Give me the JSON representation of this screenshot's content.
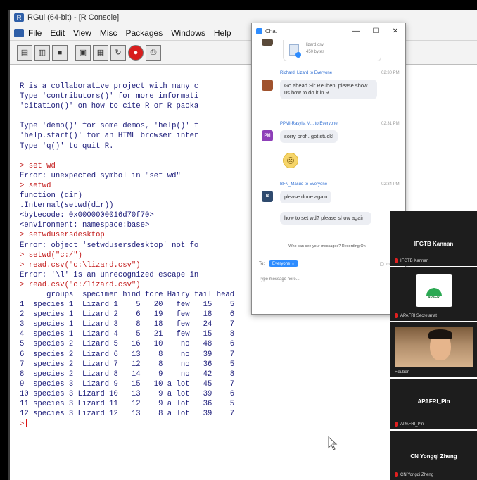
{
  "rgui": {
    "title": "RGui (64-bit) - [R Console]",
    "menu": [
      "File",
      "Edit",
      "View",
      "Misc",
      "Packages",
      "Windows",
      "Help"
    ],
    "toolbar_icons": [
      "open-script-icon",
      "load-workspace-icon",
      "save-workspace-icon",
      "copy-icon",
      "paste-icon",
      "copy-paste-icon",
      "stop-icon",
      "print-icon"
    ]
  },
  "console": {
    "intro": [
      "R is a collaborative project with many c",
      "Type 'contributors()' for more informati",
      "'citation()' on how to cite R or R packa",
      "",
      "Type 'demo()' for some demos, 'help()' f",
      "'help.start()' for an HTML browser inter",
      "Type 'q()' to quit R.",
      ""
    ],
    "lines": [
      {
        "k": "cmd",
        "t": "> set wd"
      },
      {
        "k": "out",
        "t": "Error: unexpected symbol in \"set wd\""
      },
      {
        "k": "cmd",
        "t": "> setwd"
      },
      {
        "k": "out",
        "t": "function (dir)"
      },
      {
        "k": "out",
        "t": ".Internal(setwd(dir))"
      },
      {
        "k": "out",
        "t": "<bytecode: 0x0000000016d70f70>"
      },
      {
        "k": "out",
        "t": "<environment: namespace:base>"
      },
      {
        "k": "cmd",
        "t": "> setwdusersdesktop"
      },
      {
        "k": "out",
        "t": "Error: object 'setwdusersdesktop' not fo"
      },
      {
        "k": "cmd",
        "t": "> setwd(\"c:/\")"
      },
      {
        "k": "cmd",
        "t": "> read.csv(\"c:\\lizard.csv\")"
      },
      {
        "k": "out",
        "t": "Error: '\\l' is an unrecognized escape in"
      },
      {
        "k": "cmd",
        "t": "> read.csv(\"c:/lizard.csv\")"
      },
      {
        "k": "out",
        "t": "      groups  specimen hind fore Hairy tail head"
      },
      {
        "k": "out",
        "t": "1  species 1  Lizard 1    5   20   few   15    5"
      },
      {
        "k": "out",
        "t": "2  species 1  Lizard 2    6   19   few   18    6"
      },
      {
        "k": "out",
        "t": "3  species 1  Lizard 3    8   18   few   24    7"
      },
      {
        "k": "out",
        "t": "4  species 1  Lizard 4    5   21   few   15    8"
      },
      {
        "k": "out",
        "t": "5  species 2  Lizard 5   16   10    no   48    6"
      },
      {
        "k": "out",
        "t": "6  species 2  Lizard 6   13    8    no   39    7"
      },
      {
        "k": "out",
        "t": "7  species 2  Lizard 7   12    8    no   36    5"
      },
      {
        "k": "out",
        "t": "8  species 2  Lizard 8   14    9    no   42    8"
      },
      {
        "k": "out",
        "t": "9  species 3  Lizard 9   15   10 a lot   45    7"
      },
      {
        "k": "out",
        "t": "10 species 3 Lizard 10   13    9 a lot   39    6"
      },
      {
        "k": "out",
        "t": "11 species 3 Lizard 11   12    9 a lot   36    5"
      },
      {
        "k": "out",
        "t": "12 species 3 Lizard 12   13    8 a lot   39    7"
      }
    ],
    "prompt": ">"
  },
  "chat": {
    "title": "Chat",
    "window_buttons": [
      "—",
      "☐",
      "✕"
    ],
    "file": {
      "name": "lizard.csv",
      "size": "450 bytes"
    },
    "messages": [
      {
        "sender": "Richard_Lizard",
        "to": "to Everyone",
        "time": "02:30 PM",
        "text": "Go ahead Sir Reuben, please show us how to do it in R."
      },
      {
        "sender": "PPMI-Rasyila M...",
        "to": "to Everyone",
        "time": "02:31 PM",
        "avatar": "PM",
        "text": "sorry prof.. got stuck!"
      },
      {
        "emoji": "☹"
      },
      {
        "sender": "BFN_Masud",
        "to": "to Everyone",
        "time": "02:34 PM",
        "avatar": "B",
        "text": "please done again"
      },
      {
        "text": "how to set wd? please show again"
      }
    ],
    "who_can_see": "Who can see your messages? Recording On",
    "to_label": "To:",
    "to_value": "Everyone ⌄",
    "tools": "▢ ☺ …",
    "input_placeholder": "Type message here..."
  },
  "participants": [
    {
      "center": "IFGTB Kannan",
      "label": "IFGTB Kannan"
    },
    {
      "label": "APAFRI Secretariat",
      "logo_text": "APAFRI"
    },
    {
      "label": "Reuben"
    },
    {
      "center": "APAFRI_Pin",
      "label": "APAFRI_Pin"
    },
    {
      "center": "CN Yongqi Zheng",
      "label": "CN Yongqi Zheng"
    }
  ]
}
